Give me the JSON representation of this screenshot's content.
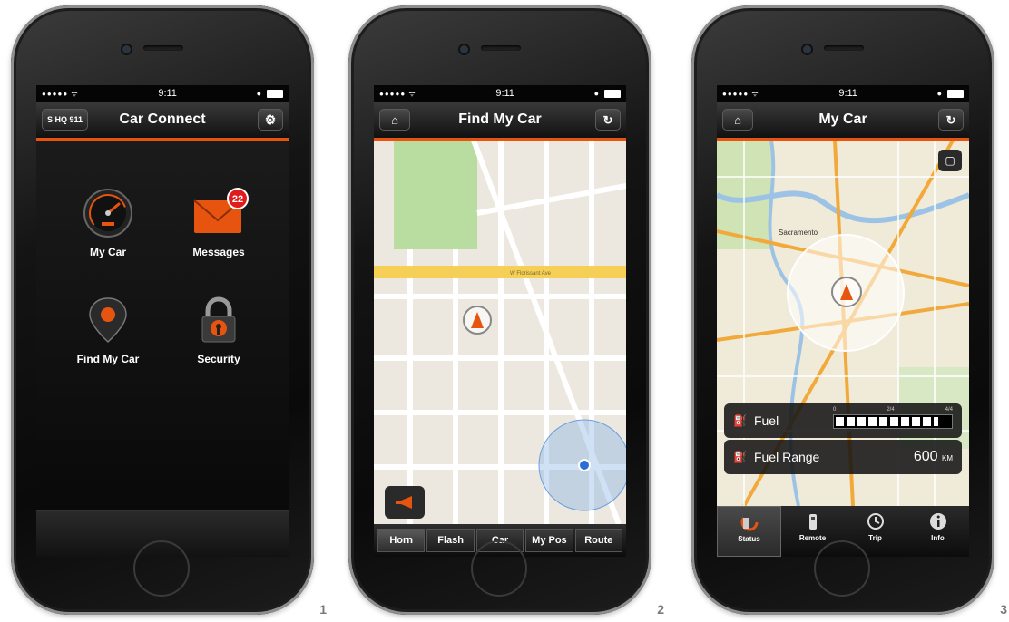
{
  "status": {
    "time": "9:11",
    "signal": "●●●●● ᯤ"
  },
  "screen1": {
    "title": "Car Connect",
    "plate": "S HQ 911",
    "tiles": [
      {
        "label": "My Car",
        "icon": "speedometer-icon"
      },
      {
        "label": "Messages",
        "icon": "envelope-icon",
        "badge": "22"
      },
      {
        "label": "Find My Car",
        "icon": "map-pin-icon"
      },
      {
        "label": "Security",
        "icon": "padlock-icon"
      }
    ],
    "number": "1"
  },
  "screen2": {
    "title": "Find My Car",
    "street_main": "W Florissant Ave",
    "buttons": [
      "Horn",
      "Flash",
      "Car",
      "My Pos",
      "Route"
    ],
    "active_button": "Horn",
    "number": "2"
  },
  "screen3": {
    "title": "My Car",
    "city": "Sacramento",
    "fuel_label": "Fuel",
    "fuel_scale": [
      "0",
      "2/4",
      "4/4"
    ],
    "fuel_level": 0.9,
    "range_label": "Fuel Range",
    "range_value": "600",
    "range_unit": "KM",
    "tabs": [
      "Status",
      "Remote",
      "Trip",
      "Info"
    ],
    "active_tab": "Status",
    "number": "3"
  },
  "colors": {
    "accent": "#e6540f",
    "badge": "#e01b1b"
  }
}
